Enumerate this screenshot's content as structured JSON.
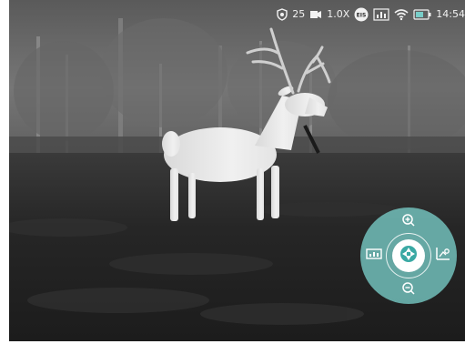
{
  "status_bar": {
    "icons": [
      "shield-icon",
      "video-record-icon",
      "eis-icon",
      "hdr-icon",
      "wifi-icon",
      "battery-icon"
    ],
    "shield_value": "25",
    "zoom_label": "1.0X",
    "eis_label": "EIS",
    "time": "14:54"
  },
  "control_wheel": {
    "color": "#78cdc8",
    "top_button": "zoom-in-icon",
    "bottom_button": "zoom-out-icon",
    "left_button": "image-mode-icon",
    "right_button": "settings-chart-icon",
    "center_button": "shutter-aperture-icon"
  },
  "palette": {
    "sky": "#6f6f6f",
    "ground": "#1f1f1f",
    "deer": "#e6e6e6",
    "accent": "#78cdc8"
  }
}
